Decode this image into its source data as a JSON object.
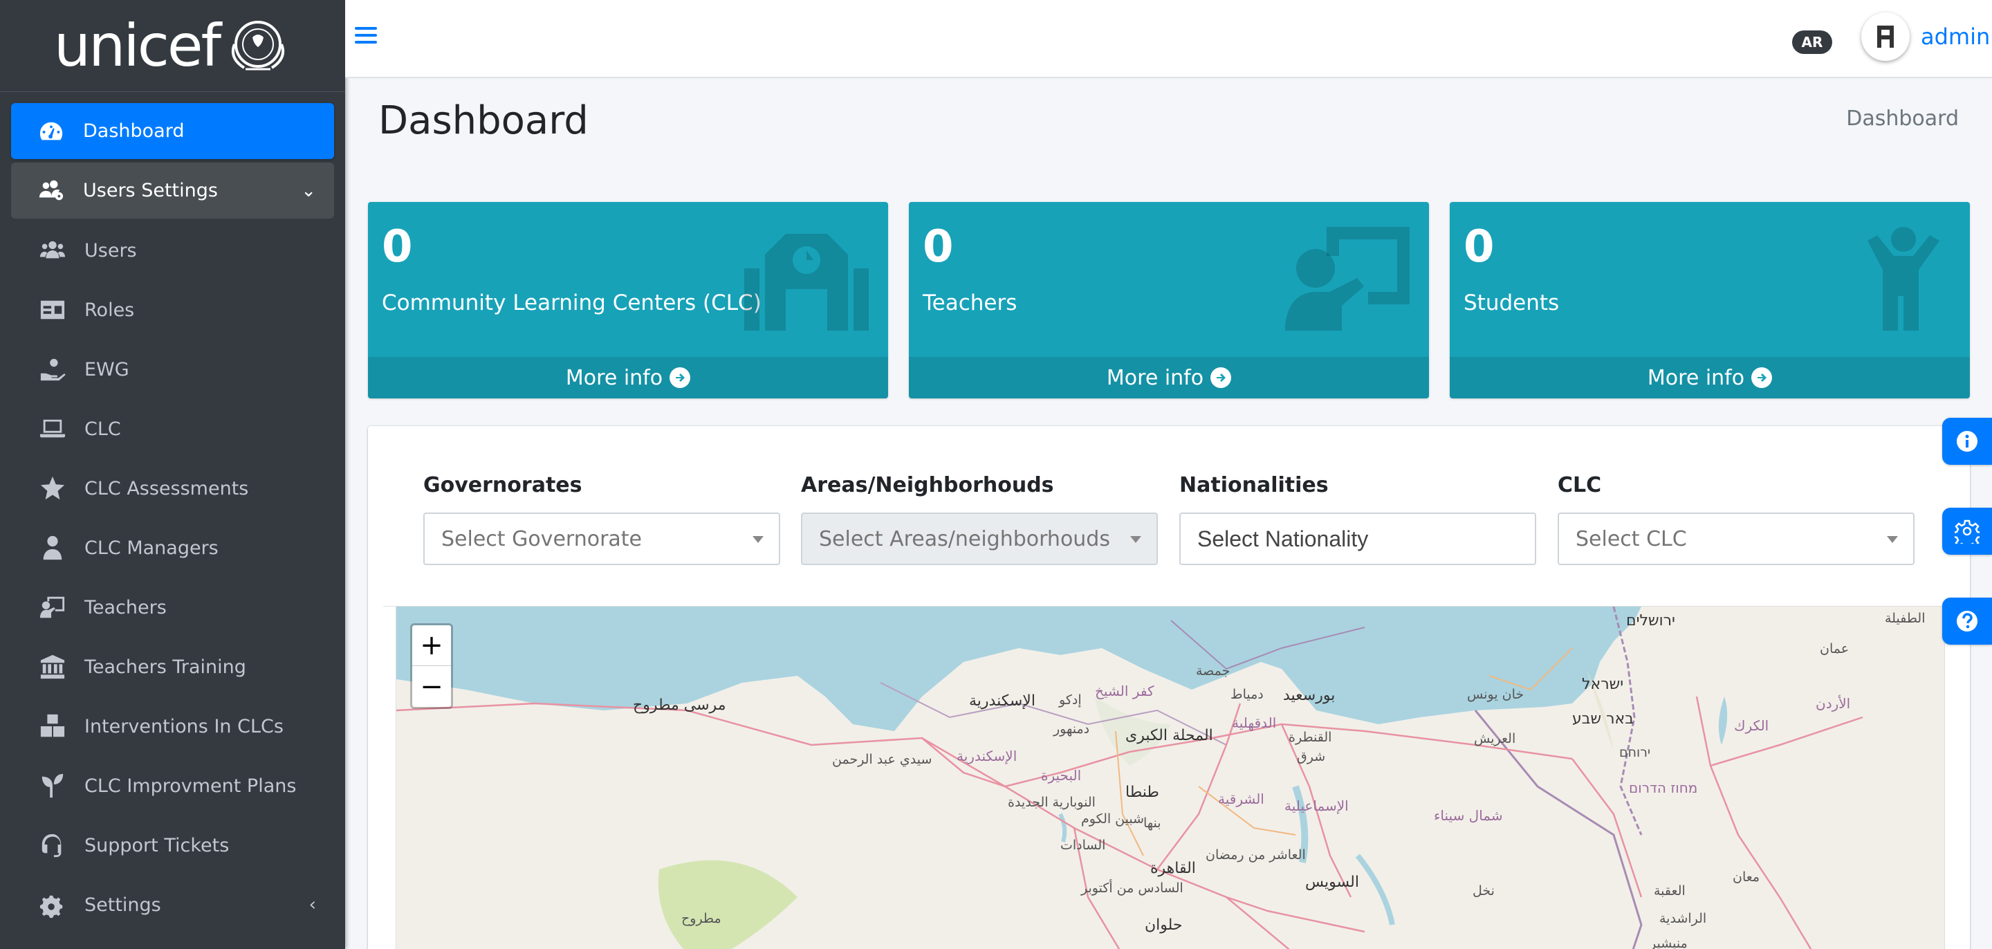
{
  "brand": {
    "name": "unicef"
  },
  "topbar": {
    "language": "AR",
    "user": "admin"
  },
  "header": {
    "title": "Dashboard",
    "breadcrumb": "Dashboard"
  },
  "sidebar": {
    "items": [
      {
        "label": "Dashboard",
        "icon": "tachometer-icon"
      },
      {
        "label": "Users Settings",
        "icon": "users-cog-icon"
      },
      {
        "label": "Users",
        "icon": "users-icon"
      },
      {
        "label": "Roles",
        "icon": "id-card-icon"
      },
      {
        "label": "EWG",
        "icon": "hand-holding-icon"
      },
      {
        "label": "CLC",
        "icon": "laptop-icon"
      },
      {
        "label": "CLC Assessments",
        "icon": "star-icon"
      },
      {
        "label": "CLC Managers",
        "icon": "user-tie-icon"
      },
      {
        "label": "Teachers",
        "icon": "chalkboard-teacher-icon"
      },
      {
        "label": "Teachers Training",
        "icon": "university-icon"
      },
      {
        "label": "Interventions In CLCs",
        "icon": "boxes-icon"
      },
      {
        "label": "CLC Improvment Plans",
        "icon": "seedling-icon"
      },
      {
        "label": "Support Tickets",
        "icon": "headset-icon"
      },
      {
        "label": "Settings",
        "icon": "cogs-icon"
      }
    ]
  },
  "stats": [
    {
      "count": "0",
      "label": "Community Learning Centers (CLC)",
      "link": "More info",
      "icon": "school-icon"
    },
    {
      "count": "0",
      "label": "Teachers",
      "link": "More info",
      "icon": "chalkboard-teacher-icon"
    },
    {
      "count": "0",
      "label": "Students",
      "link": "More info",
      "icon": "child-icon"
    }
  ],
  "filters": {
    "governorates": {
      "label": "Governorates",
      "placeholder": "Select Governorate"
    },
    "areas": {
      "label": "Areas/Neighborhouds",
      "placeholder": "Select Areas/neighborhouds"
    },
    "nationalities": {
      "label": "Nationalities",
      "placeholder": "Select Nationality"
    },
    "clc": {
      "label": "CLC",
      "placeholder": "Select CLC"
    }
  },
  "map": {
    "zoom_in": "+",
    "zoom_out": "−",
    "labels": [
      "ירושלים",
      "مرسى مطروح",
      "الإسكندرية",
      "إدكو",
      "كفر الشيخ",
      "جمصة",
      "دمياط",
      "بورسعيد",
      "خان يونس",
      "ישראל",
      "الطفيلة",
      "عمان",
      "دمنهور",
      "المحلة الكبرى",
      "الدقهلية",
      "القنطرة",
      "العريش",
      "באר שבע",
      "الكرك",
      "الأردن",
      "سيدي عبد الرحمن",
      "الإسكندرية",
      "البحيرة",
      "شرق",
      "ירוחם",
      "מחוז הדרום",
      "طنطا",
      "الشرقية",
      "النوبارية الجديدة",
      "الإسماعيلية",
      "شمال سيناء",
      "بنها",
      "شبين الكوم",
      "السادات",
      "القاهرة",
      "العاشر من رمضان",
      "السويس",
      "السادس من أكتوبر",
      "مطروح",
      "نخل",
      "حلوان",
      "العقبة",
      "معان",
      "الراشدية",
      "منيشير"
    ]
  },
  "colors": {
    "sidebar_bg": "#343a40",
    "accent": "#007bff",
    "info_box": "#17a2b8"
  }
}
